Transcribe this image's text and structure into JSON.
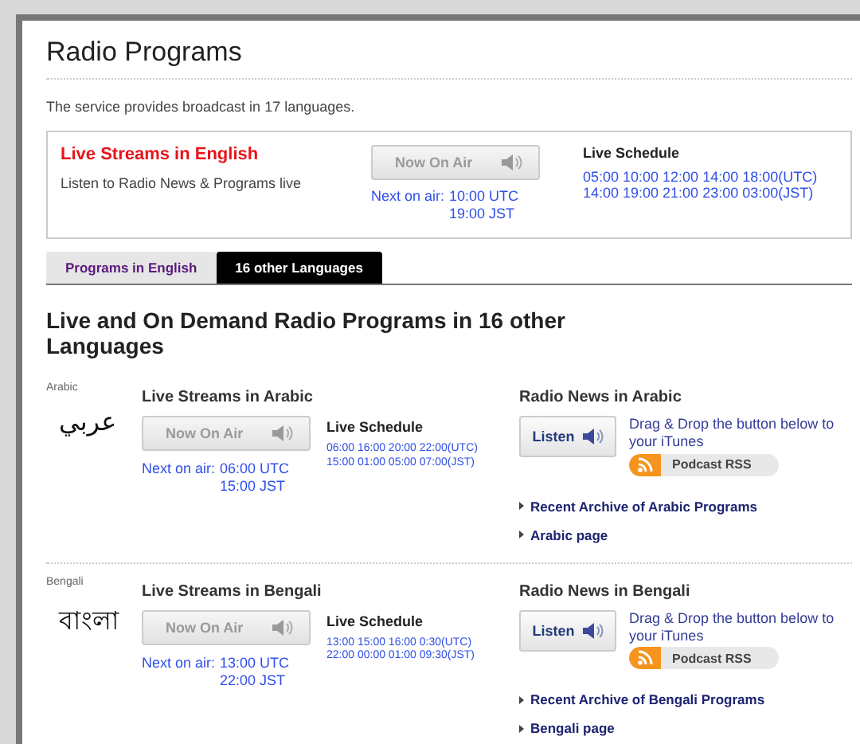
{
  "title": "Radio Programs",
  "description": "The service provides broadcast in 17 languages.",
  "english": {
    "heading": "Live Streams in English",
    "subtitle": "Listen to Radio News & Programs live",
    "button": {
      "label": "Now On Air",
      "disabled": true
    },
    "next_label": "Next on air:",
    "next_utc": "10:00 UTC",
    "next_jst": "19:00 JST",
    "schedule_heading": "Live Schedule",
    "schedule_utc": "05:00 10:00 12:00 14:00 18:00(UTC)",
    "schedule_jst": "14:00 19:00 21:00 23:00 03:00(JST)"
  },
  "tabs": [
    {
      "label": "Programs in English",
      "selected": false
    },
    {
      "label": "16 other Languages",
      "selected": true
    }
  ],
  "section_heading": "Live and On Demand Radio Programs in 16 other Languages",
  "languages": [
    {
      "label": "Arabic",
      "script": "عربي",
      "live_heading": "Live Streams in Arabic",
      "button": {
        "label": "Now On Air",
        "disabled": true
      },
      "next_label": "Next on air:",
      "next_utc": "06:00 UTC",
      "next_jst": "15:00 JST",
      "schedule_heading": "Live Schedule",
      "schedule_utc": "06:00 16:00 20:00 22:00(UTC)",
      "schedule_jst": "15:00 01:00 05:00 07:00(JST)",
      "news_heading": "Radio News in Arabic",
      "listen": "Listen",
      "drag_text": "Drag & Drop the button below to your iTunes",
      "podcast": "Podcast RSS",
      "links": [
        "Recent Archive of Arabic Programs",
        "Arabic page"
      ]
    },
    {
      "label": "Bengali",
      "script": "বাংলা",
      "live_heading": "Live Streams in Bengali",
      "button": {
        "label": "Now On Air",
        "disabled": true
      },
      "next_label": "Next on air:",
      "next_utc": "13:00 UTC",
      "next_jst": "22:00 JST",
      "schedule_heading": "Live Schedule",
      "schedule_utc": "13:00 15:00 16:00 0:30(UTC)",
      "schedule_jst": "22:00 00:00 01:00 09:30(JST)",
      "news_heading": "Radio News in Bengali",
      "listen": "Listen",
      "drag_text": "Drag & Drop the button below to your iTunes",
      "podcast": "Podcast RSS",
      "links": [
        "Recent Archive of Bengali Programs",
        "Bengali page"
      ]
    }
  ]
}
